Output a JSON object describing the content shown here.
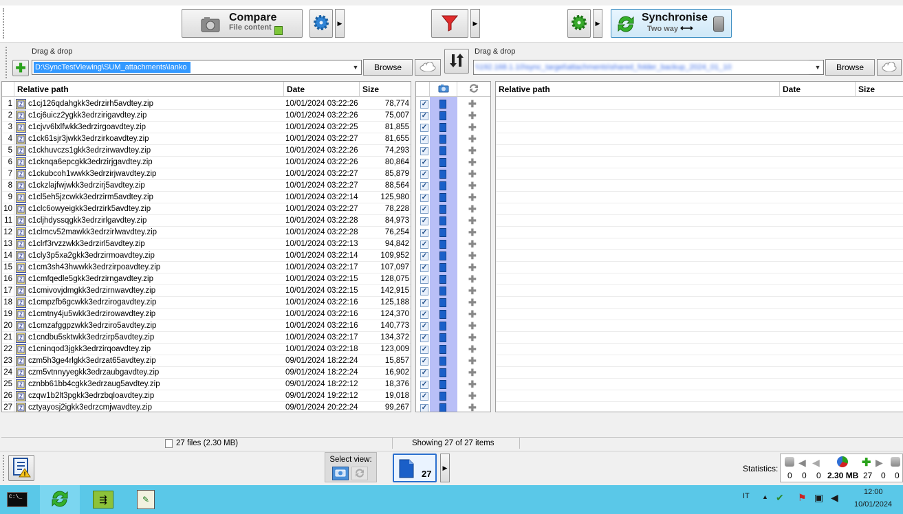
{
  "toolbar": {
    "compare_title": "Compare",
    "compare_sub": "File content",
    "sync_title": "Synchronise",
    "sync_sub": "Two way"
  },
  "left_folder": {
    "label": "Drag & drop",
    "path": "D:\\SyncTestViewing\\SUM_attachments\\Ianko",
    "browse": "Browse"
  },
  "right_folder": {
    "label": "Drag & drop",
    "path": "\\\\192.168.1.10\\sync_target\\attachments\\shared_folder_backup_2024_01_10",
    "browse": "Browse"
  },
  "left_headers": {
    "path": "Relative path",
    "date": "Date",
    "size": "Size"
  },
  "right_headers": {
    "path": "Relative path",
    "date": "Date",
    "size": "Size"
  },
  "files": [
    {
      "n": "1",
      "name": "c1cj126qdahgkk3edrzirh5avdtey.zip",
      "date": "10/01/2024  03:22:26",
      "size": "78,774"
    },
    {
      "n": "2",
      "name": "c1cj6uicz2ygkk3edrzirigavdtey.zip",
      "date": "10/01/2024  03:22:26",
      "size": "75,007"
    },
    {
      "n": "3",
      "name": "c1cjvv6lxlfwkk3edrzirgoavdtey.zip",
      "date": "10/01/2024  03:22:25",
      "size": "81,855"
    },
    {
      "n": "4",
      "name": "c1ck61sjr3jwkk3edrzirkoavdtey.zip",
      "date": "10/01/2024  03:22:27",
      "size": "81,655"
    },
    {
      "n": "5",
      "name": "c1ckhuvczs1gkk3edrzirwavdtey.zip",
      "date": "10/01/2024  03:22:26",
      "size": "74,293"
    },
    {
      "n": "6",
      "name": "c1cknqa6epcgkk3edrzirjgavdtey.zip",
      "date": "10/01/2024  03:22:26",
      "size": "80,864"
    },
    {
      "n": "7",
      "name": "c1ckubcoh1wwkk3edrzirjwavdtey.zip",
      "date": "10/01/2024  03:22:27",
      "size": "85,879"
    },
    {
      "n": "8",
      "name": "c1ckzlajfwjwkk3edrzirj5avdtey.zip",
      "date": "10/01/2024  03:22:27",
      "size": "88,564"
    },
    {
      "n": "9",
      "name": "c1cl5eh5jzcwkk3edrzirm5avdtey.zip",
      "date": "10/01/2024  03:22:14",
      "size": "125,980"
    },
    {
      "n": "10",
      "name": "c1clc6owyeigkk3edrzirk5avdtey.zip",
      "date": "10/01/2024  03:22:27",
      "size": "78,228"
    },
    {
      "n": "11",
      "name": "c1cljhdyssqgkk3edrzirlgavdtey.zip",
      "date": "10/01/2024  03:22:28",
      "size": "84,973"
    },
    {
      "n": "12",
      "name": "c1clmcv52mawkk3edrzirlwavdtey.zip",
      "date": "10/01/2024  03:22:28",
      "size": "76,254"
    },
    {
      "n": "13",
      "name": "c1clrf3rvzzwkk3edrzirl5avdtey.zip",
      "date": "10/01/2024  03:22:13",
      "size": "94,842"
    },
    {
      "n": "14",
      "name": "c1cly3p5xa2gkk3edrzirmoavdtey.zip",
      "date": "10/01/2024  03:22:14",
      "size": "109,952"
    },
    {
      "n": "15",
      "name": "c1cm3sh43hwwkk3edrzirpoavdtey.zip",
      "date": "10/01/2024  03:22:17",
      "size": "107,097"
    },
    {
      "n": "16",
      "name": "c1cmfqedle5gkk3edrzirngavdtey.zip",
      "date": "10/01/2024  03:22:15",
      "size": "128,075"
    },
    {
      "n": "17",
      "name": "c1cmivovjdmgkk3edrzirnwavdtey.zip",
      "date": "10/01/2024  03:22:15",
      "size": "142,915"
    },
    {
      "n": "18",
      "name": "c1cmpzfb6gcwkk3edrzirogavdtey.zip",
      "date": "10/01/2024  03:22:16",
      "size": "125,188"
    },
    {
      "n": "19",
      "name": "c1cmtny4ju5wkk3edrzirowavdtey.zip",
      "date": "10/01/2024  03:22:16",
      "size": "124,370"
    },
    {
      "n": "20",
      "name": "c1cmzafggpzwkk3edrziro5avdtey.zip",
      "date": "10/01/2024  03:22:16",
      "size": "140,773"
    },
    {
      "n": "21",
      "name": "c1cndbu5sktwkk3edrzirp5avdtey.zip",
      "date": "10/01/2024  03:22:17",
      "size": "134,372"
    },
    {
      "n": "22",
      "name": "c1cninqod3jgkk3edrzirqoavdtey.zip",
      "date": "10/01/2024  03:22:18",
      "size": "123,009"
    },
    {
      "n": "23",
      "name": "czm5h3ge4rlgkk3edrzat65avdtey.zip",
      "date": "09/01/2024  18:22:24",
      "size": "15,857"
    },
    {
      "n": "24",
      "name": "czm5vtnnyyegkk3edrzaubgavdtey.zip",
      "date": "09/01/2024  18:22:24",
      "size": "16,902"
    },
    {
      "n": "25",
      "name": "cznbb61bb4cgkk3edrzaug5avdtey.zip",
      "date": "09/01/2024  18:22:12",
      "size": "18,376"
    },
    {
      "n": "26",
      "name": "czqw1b2lt3pgkk3edrzbqloavdtey.zip",
      "date": "09/01/2024  19:22:12",
      "size": "19,018"
    },
    {
      "n": "27",
      "name": "cztyayosj2igkk3edrzcmjwavdtey.zip",
      "date": "09/01/2024  20:22:24",
      "size": "99,267"
    }
  ],
  "status": {
    "left": "27 files  (2.30 MB)",
    "middle": "Showing 27 of 27 items"
  },
  "bottom": {
    "select_view": "Select view:",
    "view_count": "27",
    "statistics_label": "Statistics:",
    "stats": [
      "0",
      "0",
      "0",
      "2.30 MB",
      "27",
      "0",
      "0"
    ]
  },
  "taskbar": {
    "lang": "IT",
    "time": "12:00",
    "date": "10/01/2024"
  },
  "colors": {
    "taskbar": "#5ac8e8",
    "selection": "#3399ff",
    "mid_col": "#b9bff7"
  }
}
